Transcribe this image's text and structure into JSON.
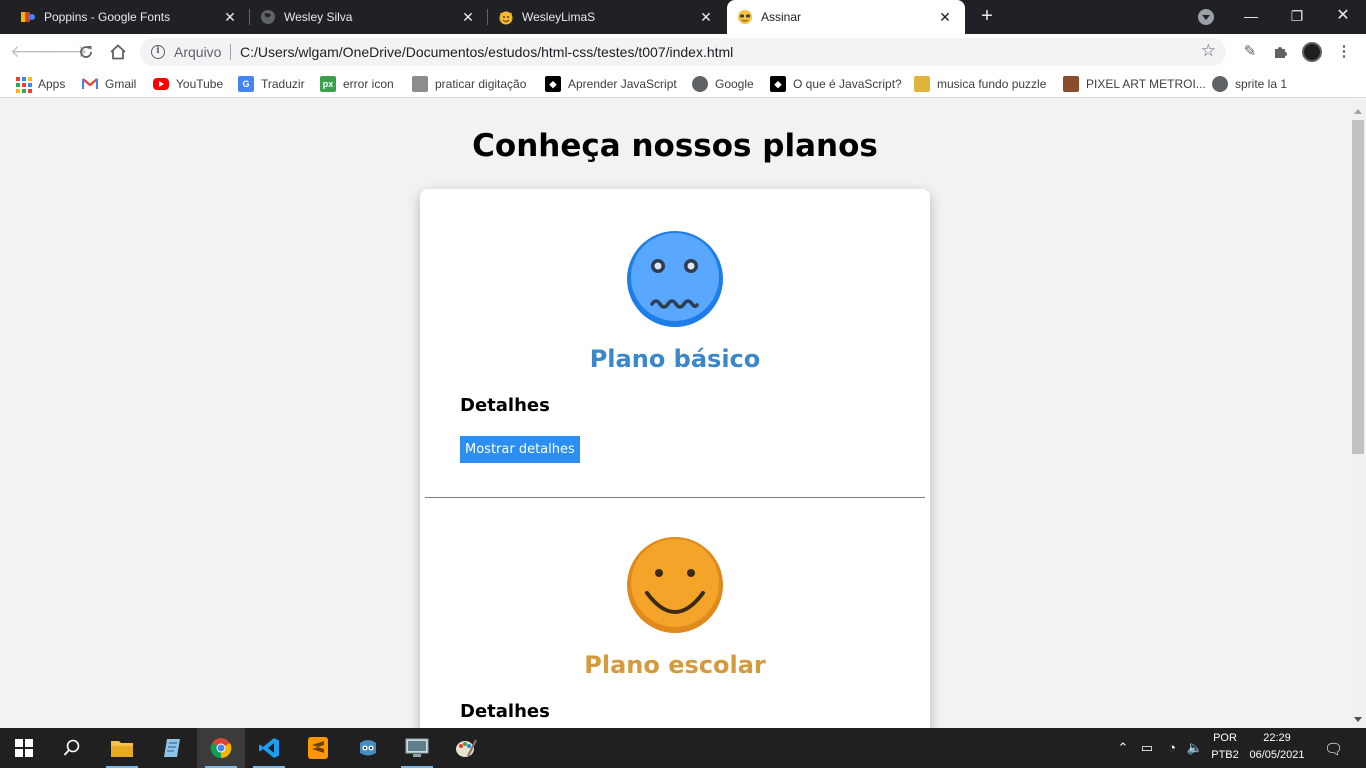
{
  "browser": {
    "tabs": [
      {
        "title": "Poppins - Google Fonts",
        "icon": "google-fonts-icon",
        "active": false
      },
      {
        "title": "Wesley Silva",
        "icon": "globe-icon",
        "active": false
      },
      {
        "title": "WesleyLimaS",
        "icon": "smiley-cat-icon",
        "active": false
      },
      {
        "title": "Assinar",
        "icon": "sunglasses-emoji-icon",
        "active": true
      }
    ],
    "close_glyph": "✕",
    "new_tab_glyph": "+",
    "window_controls": {
      "minimize": "—",
      "restore": "❐",
      "close": "✕"
    },
    "address": {
      "security_label": "Arquivo",
      "url": "C:/Users/wlgam/OneDrive/Documentos/estudos/html-css/testes/t007/index.html"
    },
    "bookmarks": [
      {
        "label": "Apps",
        "icon": "apps-grid-icon"
      },
      {
        "label": "Gmail",
        "icon": "gmail-icon"
      },
      {
        "label": "YouTube",
        "icon": "youtube-icon"
      },
      {
        "label": "Traduzir",
        "icon": "translate-icon"
      },
      {
        "label": "error icon",
        "icon": "px-icon"
      },
      {
        "label": "praticar digitação",
        "icon": "typing-icon"
      },
      {
        "label": "Aprender JavaScript",
        "icon": "bookmark-black-icon"
      },
      {
        "label": "Google",
        "icon": "globe-icon"
      },
      {
        "label": "O que é JavaScript?",
        "icon": "bookmark-black-icon"
      },
      {
        "label": "musica fundo puzzle",
        "icon": "music-icon"
      },
      {
        "label": "PIXEL ART METROI...",
        "icon": "pixel-art-icon"
      },
      {
        "label": "sprite la 1",
        "icon": "globe-icon"
      }
    ]
  },
  "page": {
    "title": "Conheça nossos planos",
    "plans": [
      {
        "name": "Plano básico",
        "name_color": "#3a87c9",
        "emoji": "nervous-face-icon",
        "emoji_color": "#5aa7ff",
        "details_heading": "Detalhes",
        "button_label": "Mostrar detalhes"
      },
      {
        "name": "Plano escolar",
        "name_color": "#d39a3e",
        "emoji": "smiling-face-icon",
        "emoji_color": "#f5a42a",
        "details_heading": "Detalhes"
      }
    ]
  },
  "taskbar": {
    "apps": [
      "start-icon",
      "search-icon",
      "file-explorer-icon",
      "notepad-icon",
      "chrome-icon",
      "vscode-icon",
      "sublime-text-icon",
      "godot-icon",
      "remote-desktop-icon",
      "paint-icon"
    ],
    "language": "POR",
    "keyboard": "PTB2",
    "time": "22:29",
    "date": "06/05/2021"
  }
}
